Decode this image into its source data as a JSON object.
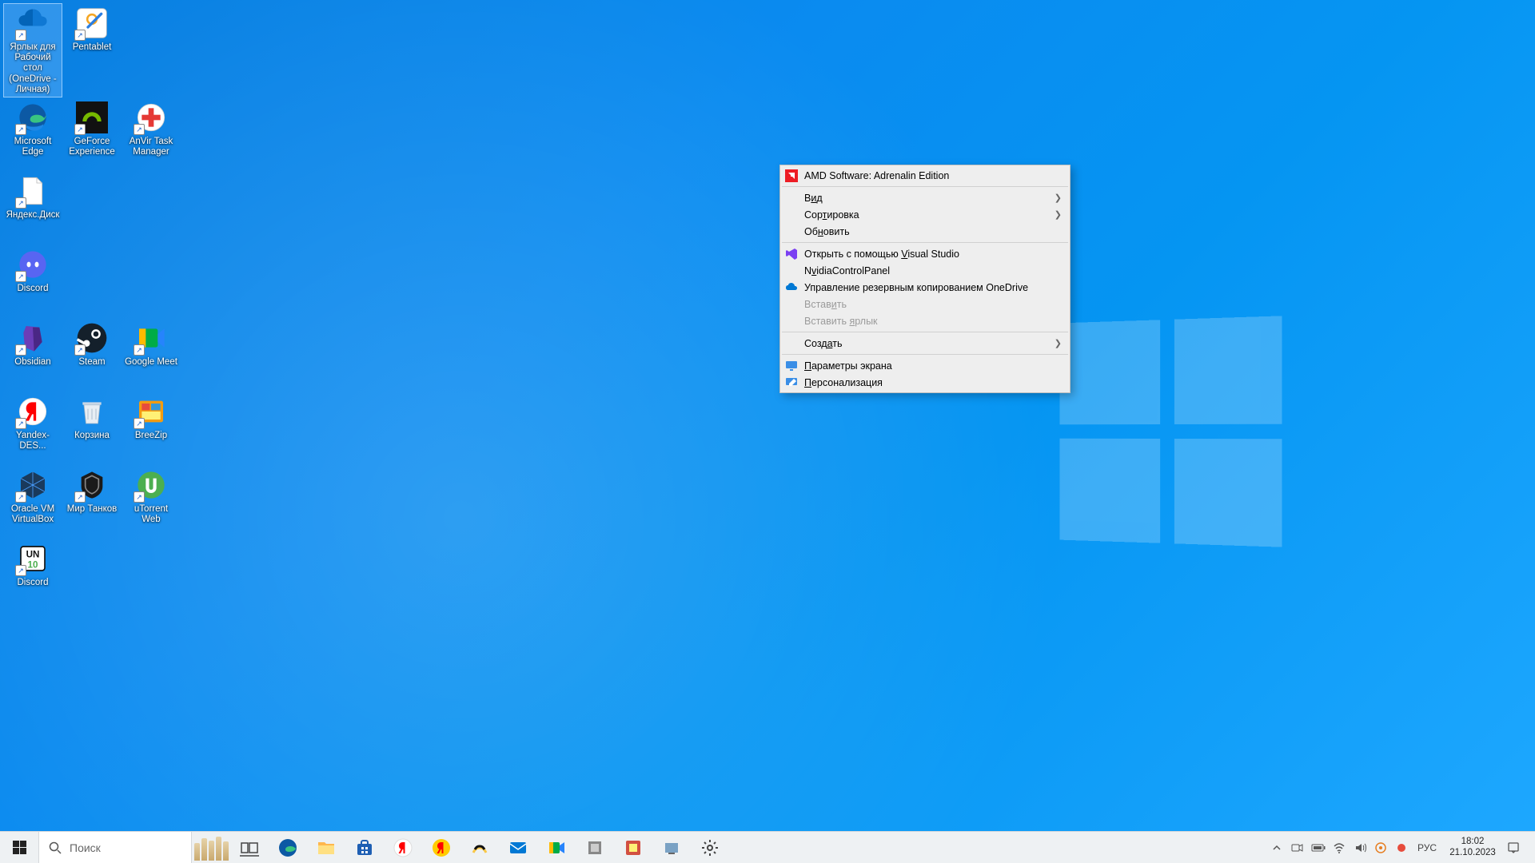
{
  "desktop_icons": {
    "onedrive_shortcut": "Ярлык для Рабочий стол (OneDrive - Личная)",
    "pentablet": "Pentablet",
    "edge": "Microsoft Edge",
    "geforce": "GeForce Experience",
    "anvir": "AnVir Task Manager",
    "yadisk": "Яндекс.Диск",
    "discord": "Discord",
    "obsidian": "Obsidian",
    "steam": "Steam",
    "gmeet": "Google Meet",
    "yandex_des": "Yandex-DES...",
    "recycle": "Корзина",
    "breezip": "BreeZip",
    "vbox": "Oracle VM VirtualBox",
    "wot": "Мир Танков",
    "utorrent": "uTorrent Web",
    "discord2": "Discord"
  },
  "context_menu": {
    "amd": "AMD Software: Adrenalin Edition",
    "view": "Вид",
    "view_ul": "и",
    "sort": "Сортировка",
    "sort_ul": "т",
    "refresh": "Обновить",
    "refresh_ul": "н",
    "open_vs": "Открыть с помощью Visual Studio",
    "open_vs_ul": "V",
    "nvidia": "NvidiaControlPanel",
    "nvidia_ul": "v",
    "onedrive_backup": "Управление резервным копированием OneDrive",
    "paste": "Вставить",
    "paste_ul": "и",
    "paste_shortcut": "Вставить ярлык",
    "paste_shortcut_ul": "я",
    "create": "Создать",
    "create_ul": "а",
    "display_settings": "Параметры экрана",
    "display_ul": "П",
    "personalize": "Персонализация",
    "personalize_ul": "П"
  },
  "taskbar": {
    "search_placeholder": "Поиск",
    "apps": {
      "task_view": "task-view",
      "edge": "edge",
      "explorer": "explorer",
      "store": "store",
      "yandex": "yandex-browser",
      "yandex_search": "yandex-search",
      "music": "music",
      "mail": "mail",
      "meet": "meet",
      "app8": "pinned-app",
      "app9": "pinned-app",
      "app10": "pinned-app",
      "settings": "settings"
    }
  },
  "tray": {
    "language": "РУС",
    "time": "18:02",
    "date": "21.10.2023"
  }
}
